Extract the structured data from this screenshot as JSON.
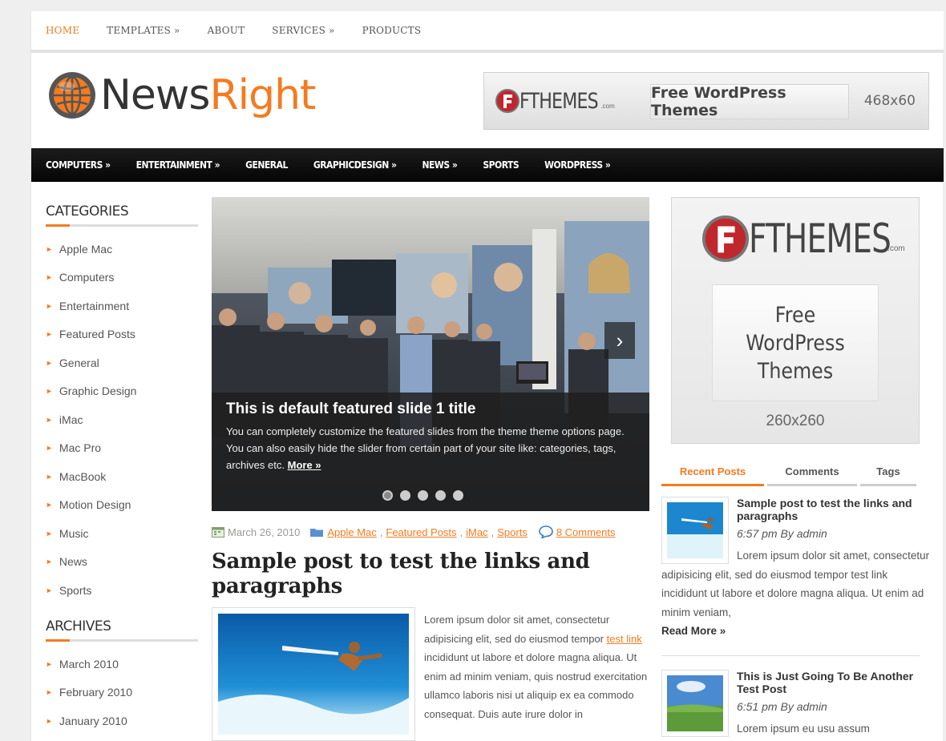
{
  "top_nav": {
    "items": [
      {
        "label": "HOME",
        "active": true
      },
      {
        "label": "TEMPLATES »"
      },
      {
        "label": "ABOUT"
      },
      {
        "label": "SERVICES »"
      },
      {
        "label": "PRODUCTS"
      }
    ]
  },
  "logo": {
    "part1": "News",
    "part2": "Right"
  },
  "banner": {
    "brand": "FTHEMES",
    "brand_suffix": ".com",
    "button": "Free WordPress Themes",
    "size": "468x60"
  },
  "main_nav": {
    "items": [
      "COMPUTERS »",
      "ENTERTAINMENT »",
      "GENERAL",
      "GRAPHICDESIGN »",
      "NEWS »",
      "SPORTS",
      "WORDPRESS »"
    ]
  },
  "categories": {
    "title": "CATEGORIES",
    "items": [
      "Apple Mac",
      "Computers",
      "Entertainment",
      "Featured Posts",
      "General",
      "Graphic Design",
      "iMac",
      "Mac Pro",
      "MacBook",
      "Motion Design",
      "Music",
      "News",
      "Sports"
    ]
  },
  "archives": {
    "title": "ARCHIVES",
    "items": [
      "March 2010",
      "February 2010",
      "January 2010"
    ]
  },
  "slider": {
    "title": "This is default featured slide 1 title",
    "description": "You can completely customize the featured slides from the theme theme options page. You can also easily hide the slider from certain part of your site like: categories, tags, archives etc.",
    "more": "More »",
    "slide_count": 5,
    "active_slide": 1
  },
  "post": {
    "date": "March 26, 2010",
    "categories": [
      "Apple Mac",
      "Featured Posts",
      "iMac",
      "Sports"
    ],
    "comments": "8 Comments",
    "title": "Sample post to test the links and paragraphs",
    "body_before_link": "Lorem ipsum dolor sit amet, consectetur adipisicing elit, sed do eiusmod tempor",
    "link": "test link",
    "body_after_link": "incididunt ut labore et dolore magna aliqua. Ut enim ad minim veniam, quis nostrud exercitation ullamco laboris nisi ut aliquip ex ea commodo consequat. Duis aute irure dolor in"
  },
  "ad_big": {
    "brand": "FTHEMES",
    "brand_suffix": ".com",
    "line1": "Free",
    "line2": "WordPress",
    "line3": "Themes",
    "size": "260x260"
  },
  "tabs": [
    {
      "label": "Recent Posts",
      "active": true
    },
    {
      "label": "Comments"
    },
    {
      "label": "Tags"
    }
  ],
  "recent_posts": [
    {
      "title": "Sample post to test the links and paragraphs",
      "time": "6:57 pm By admin",
      "text": "Lorem ipsum dolor sit amet, consectetur adipisicing elit, sed do eiusmod tempor test link incididunt ut labore et dolore magna aliqua. Ut enim ad minim veniam,",
      "more": "Read More »"
    },
    {
      "title": "This is Just Going To Be Another Test Post",
      "time": "6:51 pm By admin",
      "text": "Lorem ipsum eu usu assum"
    }
  ],
  "colors": {
    "accent": "#f47b20",
    "nav_bg": "#111111"
  }
}
